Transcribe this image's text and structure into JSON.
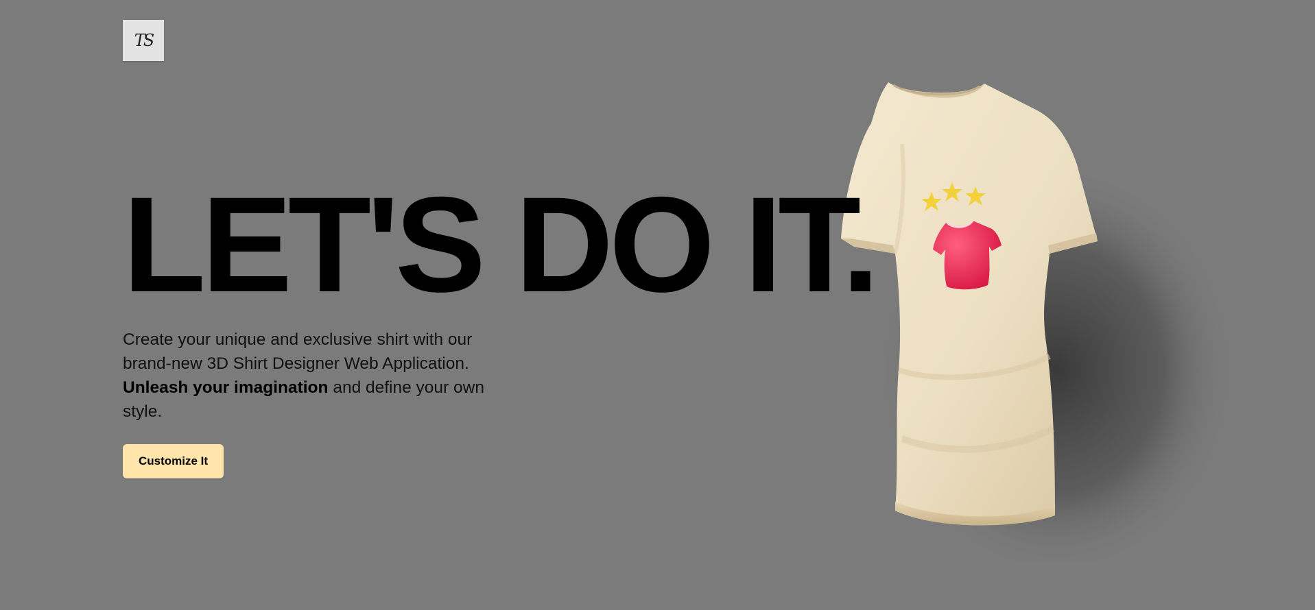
{
  "logo": {
    "text": "TS",
    "icon": "logo-icon"
  },
  "hero": {
    "title": "LET'S DO IT.",
    "description_intro": "Create your unique and exclusive shirt with our brand-new 3D Shirt Designer Web Application.",
    "description_bold": "Unleash your imagination",
    "description_outro": "and define your own style.",
    "cta_label": "Customize It"
  },
  "shirt": {
    "icon": "tshirt-icon",
    "decal_icon": "red-shirt-with-stars-icon"
  },
  "colors": {
    "background": "#7b7b7b",
    "shirt": "#efe2c8",
    "cta_background": "#ffe4ab",
    "decal": "#e8284f",
    "stars": "#f2d13a"
  }
}
